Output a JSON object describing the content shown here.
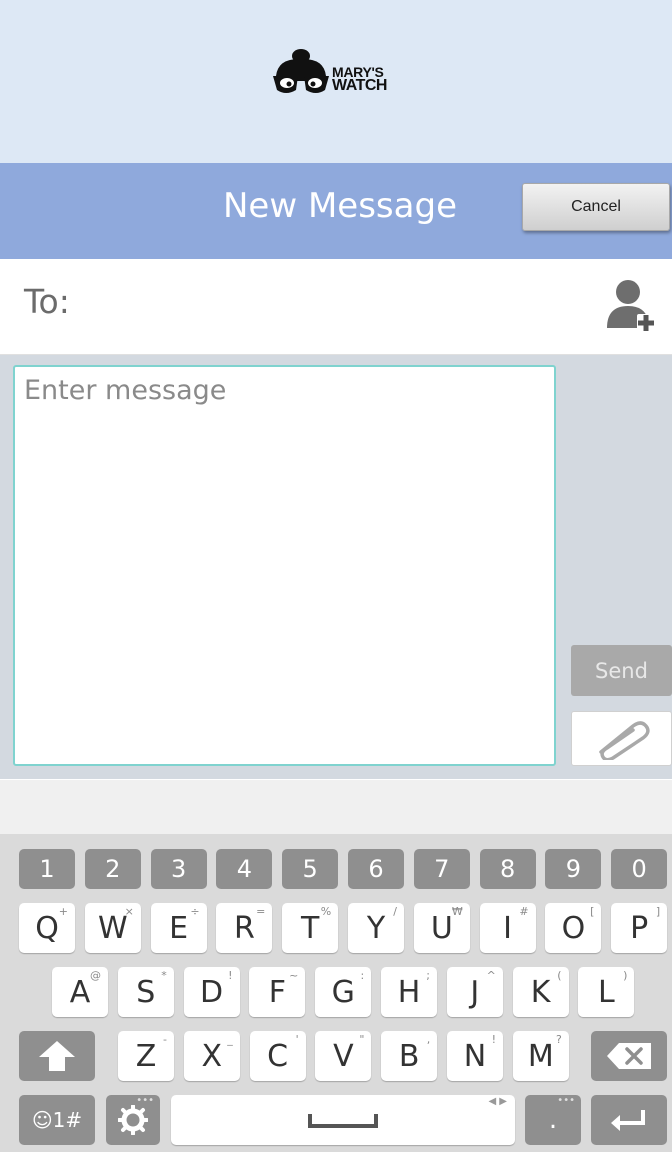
{
  "header": {
    "logo_line1": "MARY'S",
    "logo_line2": "WATCH",
    "title": "New Message",
    "cancel_label": "Cancel"
  },
  "compose": {
    "to_label": "To:",
    "message_placeholder": "Enter message",
    "send_label": "Send"
  },
  "keyboard": {
    "number_row": [
      "1",
      "2",
      "3",
      "4",
      "5",
      "6",
      "7",
      "8",
      "9",
      "0"
    ],
    "row1": [
      {
        "key": "Q",
        "alt": "+"
      },
      {
        "key": "W",
        "alt": "×"
      },
      {
        "key": "E",
        "alt": "÷"
      },
      {
        "key": "R",
        "alt": "="
      },
      {
        "key": "T",
        "alt": "%"
      },
      {
        "key": "Y",
        "alt": "/"
      },
      {
        "key": "U",
        "alt": "₩"
      },
      {
        "key": "I",
        "alt": "#"
      },
      {
        "key": "O",
        "alt": "["
      },
      {
        "key": "P",
        "alt": "]"
      }
    ],
    "row2": [
      {
        "key": "A",
        "alt": "@"
      },
      {
        "key": "S",
        "alt": "*"
      },
      {
        "key": "D",
        "alt": "!"
      },
      {
        "key": "F",
        "alt": "~"
      },
      {
        "key": "G",
        "alt": ":"
      },
      {
        "key": "H",
        "alt": ";"
      },
      {
        "key": "J",
        "alt": "^"
      },
      {
        "key": "K",
        "alt": "("
      },
      {
        "key": "L",
        "alt": ")"
      }
    ],
    "row3": [
      {
        "key": "Z",
        "alt": "-"
      },
      {
        "key": "X",
        "alt": "_"
      },
      {
        "key": "C",
        "alt": "'"
      },
      {
        "key": "V",
        "alt": "\""
      },
      {
        "key": "B",
        "alt": ","
      },
      {
        "key": "N",
        "alt": "!"
      },
      {
        "key": "M",
        "alt": "?"
      }
    ],
    "symbols_label": "☺1#",
    "period_label": "."
  },
  "colors": {
    "brand_background": "#dde8f5",
    "title_bar": "#8fa9dc",
    "message_border": "#7fd3cf",
    "keyboard_background": "#dadada"
  }
}
